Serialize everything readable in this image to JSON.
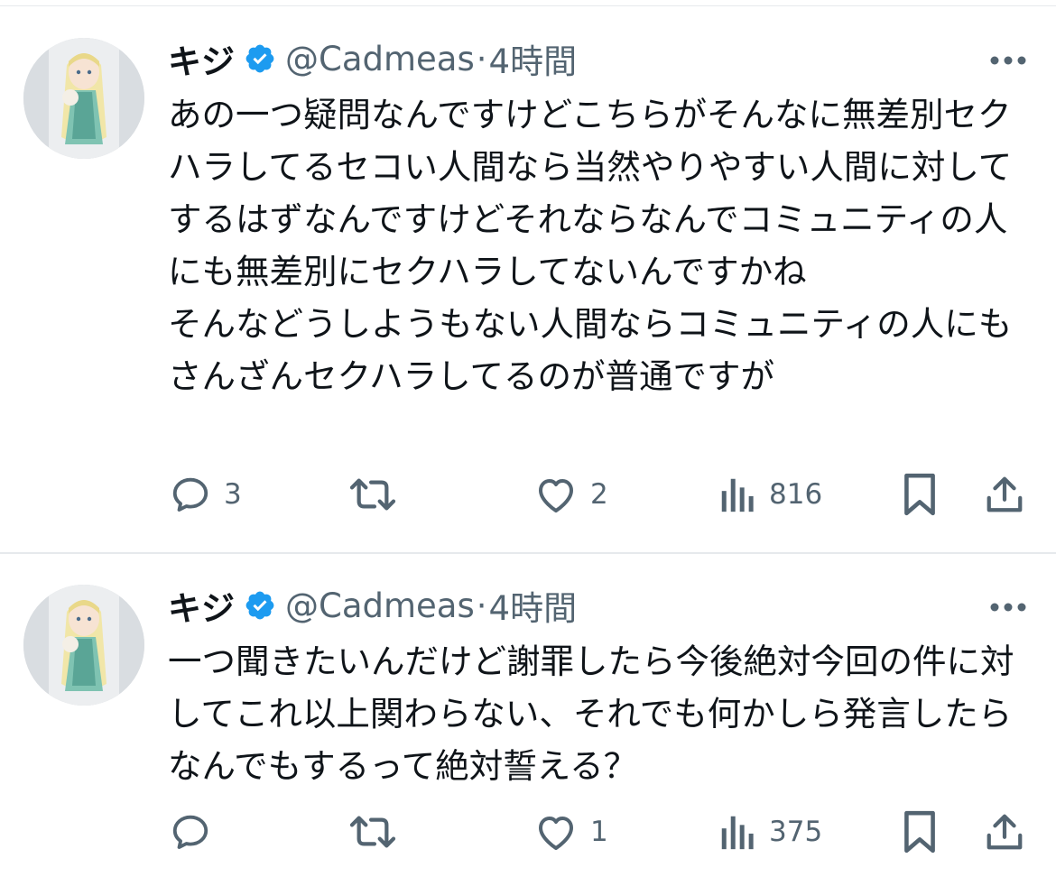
{
  "tweets": [
    {
      "author": {
        "name": "キジ",
        "handle": "@Cadmeas",
        "verified": true
      },
      "separator": "·",
      "time": "4時間",
      "text": "あの一つ疑問なんですけどこちらがそんなに無差別セクハラしてるセコい人間なら当然やりやすい人間に対してするはずなんですけどそれならなんでコミュニティの人にも無差別にセクハラしてないんですかね\nそんなどうしようもない人間ならコミュニティの人にもさんざんセクハラしてるのが普通ですが",
      "stats": {
        "replies": "3",
        "retweets": "",
        "likes": "2",
        "views": "816"
      }
    },
    {
      "author": {
        "name": "キジ",
        "handle": "@Cadmeas",
        "verified": true
      },
      "separator": "·",
      "time": "4時間",
      "text": "一つ聞きたいんだけど謝罪したら今後絶対今回の件に対してこれ以上関わらない、それでも何かしら発言したらなんでもするって絶対誓える？",
      "stats": {
        "replies": "",
        "retweets": "",
        "likes": "1",
        "views": "375"
      }
    }
  ],
  "colors": {
    "text_primary": "#0f1419",
    "text_secondary": "#536471",
    "verified_blue": "#1d9bf0",
    "divider": "#e6e9ec"
  },
  "icons": {
    "reply": "speech-bubble-icon",
    "retweet": "retweet-arrows-icon",
    "like": "heart-icon",
    "views": "bar-chart-icon",
    "bookmark": "bookmark-icon",
    "share": "share-upload-icon",
    "more": "more-dots-icon",
    "verified": "verified-badge-icon"
  }
}
